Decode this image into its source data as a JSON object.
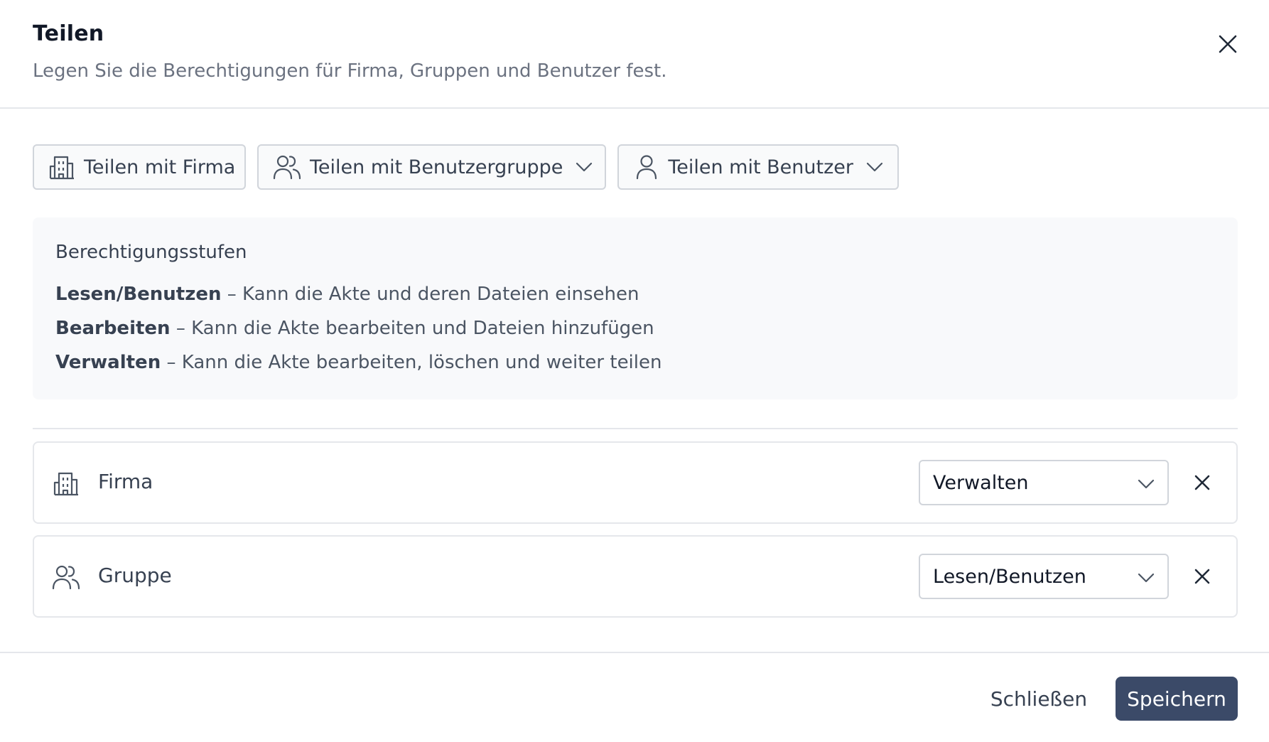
{
  "header": {
    "title": "Teilen",
    "subtitle": "Legen Sie die Berechtigungen für Firma, Gruppen und Benutzer fest.",
    "close_icon": "close-icon"
  },
  "share_buttons": [
    {
      "label": "Teilen mit Firma",
      "icon": "building-icon",
      "has_dropdown": false
    },
    {
      "label": "Teilen mit Benutzergruppe",
      "icon": "users-icon",
      "has_dropdown": true
    },
    {
      "label": "Teilen mit Benutzer",
      "icon": "user-icon",
      "has_dropdown": true
    }
  ],
  "info": {
    "title": "Berechtigungsstufen",
    "levels": [
      {
        "name": "Lesen/Benutzen",
        "description": " – Kann die Akte und deren Dateien einsehen"
      },
      {
        "name": "Bearbeiten",
        "description": " – Kann die Akte bearbeiten und Dateien hinzufügen"
      },
      {
        "name": "Verwalten",
        "description": " – Kann die Akte bearbeiten, löschen und weiter teilen"
      }
    ]
  },
  "permissions": [
    {
      "label": "Firma",
      "icon": "building-icon",
      "level": "Verwalten"
    },
    {
      "label": "Gruppe",
      "icon": "users-icon",
      "level": "Lesen/Benutzen"
    }
  ],
  "footer": {
    "close_label": "Schließen",
    "save_label": "Speichern"
  },
  "colors": {
    "primary": "#3b4a68",
    "border": "#d1d5db",
    "info_bg": "#f8f9fb"
  }
}
